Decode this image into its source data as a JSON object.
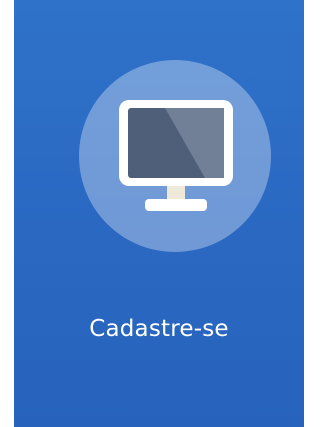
{
  "tile": {
    "label": "Cadastre-se",
    "icon": "monitor-icon"
  },
  "colors": {
    "tile_background": "#2a68c2",
    "circle": "#8fb1de",
    "screen_dark": "#4f5f79",
    "screen_light": "#6f7f98",
    "monitor_frame": "#ffffff",
    "stand": "#efe9d9"
  }
}
